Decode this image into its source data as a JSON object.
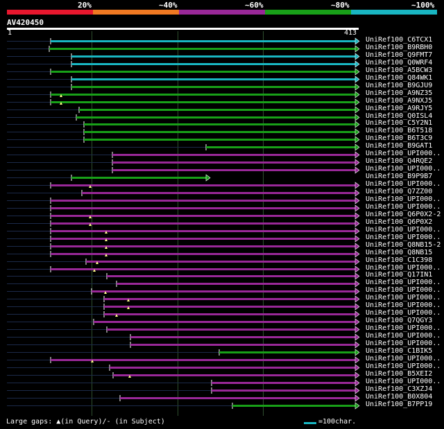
{
  "header": {
    "pct_labels": [
      "20%",
      "~40%",
      "~60%",
      "~80%",
      "~100%"
    ],
    "color_bins": [
      "#e8172e",
      "#f07922",
      "#992898",
      "#18a018",
      "#19b6c2"
    ]
  },
  "query": {
    "name": "AV420450",
    "start": "1",
    "end": "413"
  },
  "hits": [
    {
      "name": "UniRef100_C6TCX1",
      "start": 73,
      "color": "#19b6c2"
    },
    {
      "name": "UniRef100_B9RBH0",
      "start": 71,
      "color": "#18a018"
    },
    {
      "name": "UniRef100_Q9FMT7",
      "start": 103,
      "color": "#19b6c2"
    },
    {
      "name": "UniRef100_Q0WRF4",
      "start": 103,
      "color": "#19b6c2"
    },
    {
      "name": "UniRef100_A5BCW3",
      "start": 73,
      "color": "#18a018"
    },
    {
      "name": "UniRef100_Q84WK1",
      "start": 103,
      "color": "#19b6c2"
    },
    {
      "name": "UniRef100_B9GJU9",
      "start": 103,
      "color": "#18a018"
    },
    {
      "name": "UniRef100_A9NZ35",
      "start": 73,
      "color": "#18a018",
      "gap": 88
    },
    {
      "name": "UniRef100_A9NXJ5",
      "start": 73,
      "color": "#18a018",
      "gap": 88
    },
    {
      "name": "UniRef100_A9RJY5",
      "start": 114,
      "color": "#18a018"
    },
    {
      "name": "UniRef100_Q0ISL4",
      "start": 110,
      "color": "#18a018"
    },
    {
      "name": "UniRef100_C5Y2N1",
      "start": 121,
      "color": "#18a018"
    },
    {
      "name": "UniRef100_B6T518",
      "start": 121,
      "color": "#18a018"
    },
    {
      "name": "UniRef100_B6T3C9",
      "start": 121,
      "color": "#18a018"
    },
    {
      "name": "UniRef100_B9GAT1",
      "start": 297,
      "color": "#18a018"
    },
    {
      "name": "UniRef100_UPI000..",
      "start": 162,
      "color": "#992898"
    },
    {
      "name": "UniRef100_Q4RQE2",
      "start": 162,
      "color": "#992898"
    },
    {
      "name": "UniRef100_UPI000..",
      "start": 162,
      "color": "#992898"
    },
    {
      "name": "UniRef100_B9P9B7",
      "start": 103,
      "end": 297,
      "color": "#18a018"
    },
    {
      "name": "UniRef100_UPI000..",
      "start": 73,
      "color": "#992898",
      "gap": 130
    },
    {
      "name": "UniRef100_Q7ZZ00",
      "start": 118,
      "color": "#992898"
    },
    {
      "name": "UniRef100_UPI000..",
      "start": 73,
      "color": "#992898"
    },
    {
      "name": "UniRef100_UPI000..",
      "start": 73,
      "color": "#992898"
    },
    {
      "name": "UniRef100_Q6P0X2-2",
      "start": 73,
      "color": "#992898",
      "gap": 130
    },
    {
      "name": "UniRef100_Q6P0X2",
      "start": 73,
      "color": "#992898",
      "gap": 130
    },
    {
      "name": "UniRef100_UPI000..",
      "start": 73,
      "color": "#992898",
      "gap": 153
    },
    {
      "name": "UniRef100_UPI000..",
      "start": 73,
      "color": "#992898",
      "gap": 153
    },
    {
      "name": "UniRef100_Q8NB15-2",
      "start": 73,
      "color": "#992898",
      "gap": 153
    },
    {
      "name": "UniRef100_Q8NB15",
      "start": 73,
      "color": "#992898",
      "gap": 153
    },
    {
      "name": "UniRef100_C1C398",
      "start": 124,
      "color": "#992898",
      "gap": 140
    },
    {
      "name": "UniRef100_UPI000..",
      "start": 73,
      "color": "#992898",
      "gap": 136
    },
    {
      "name": "UniRef100_Q17IN1",
      "start": 154,
      "color": "#992898"
    },
    {
      "name": "UniRef100_UPI000..",
      "start": 168,
      "color": "#992898"
    },
    {
      "name": "UniRef100_UPI000..",
      "start": 132,
      "color": "#992898",
      "gap": 152
    },
    {
      "name": "UniRef100_UPI000..",
      "start": 150,
      "color": "#992898",
      "gap": 185
    },
    {
      "name": "UniRef100_UPI000..",
      "start": 150,
      "color": "#992898",
      "gap": 185
    },
    {
      "name": "UniRef100_UPI000..",
      "start": 150,
      "color": "#992898",
      "gap": 168
    },
    {
      "name": "UniRef100_Q7QGY3",
      "start": 135,
      "color": "#992898"
    },
    {
      "name": "UniRef100_UPI000..",
      "start": 154,
      "color": "#992898"
    },
    {
      "name": "UniRef100_UPI000..",
      "start": 188,
      "color": "#992898"
    },
    {
      "name": "UniRef100_UPI000..",
      "start": 188,
      "color": "#992898"
    },
    {
      "name": "UniRef100_C1BIK5",
      "start": 316,
      "color": "#18a018"
    },
    {
      "name": "UniRef100_UPI000..",
      "start": 73,
      "color": "#992898",
      "gap": 133
    },
    {
      "name": "UniRef100_UPI000..",
      "start": 158,
      "color": "#992898"
    },
    {
      "name": "UniRef100_B5XEI2",
      "start": 163,
      "color": "#992898",
      "gap": 187
    },
    {
      "name": "UniRef100_UPI000..",
      "start": 305,
      "color": "#992898"
    },
    {
      "name": "UniRef100_C3XZJ4",
      "start": 305,
      "color": "#992898"
    },
    {
      "name": "UniRef100_B0X804",
      "start": 173,
      "color": "#992898"
    },
    {
      "name": "UniRef100_B7PP19",
      "start": 335,
      "color": "#18a018"
    }
  ],
  "footer": {
    "legend_text": "Large gaps: ▲(in Query)/- (in Subject)",
    "scale_text": "=100char."
  }
}
